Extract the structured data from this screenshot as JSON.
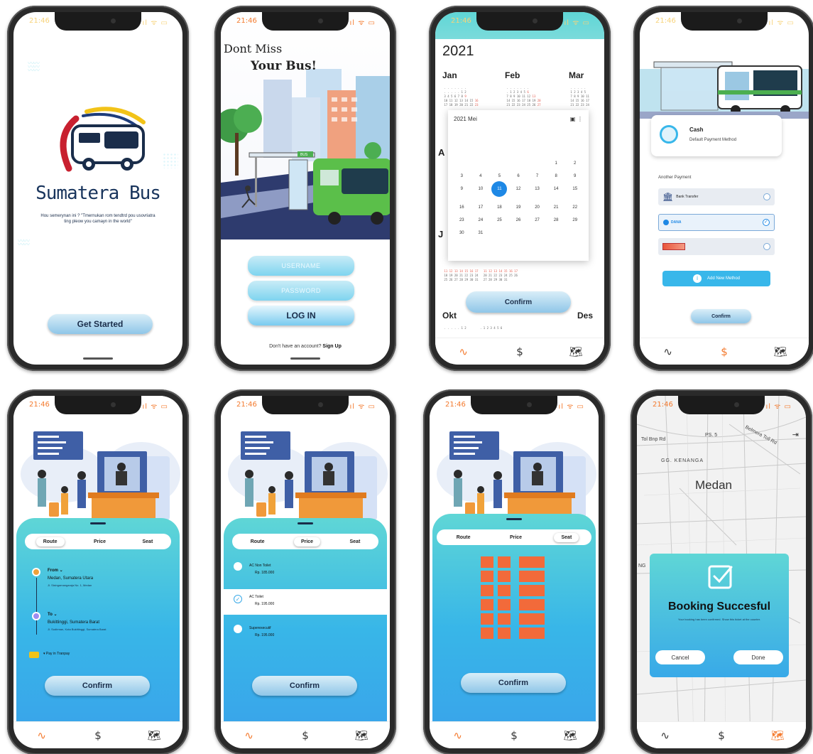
{
  "status": {
    "time": "21:46",
    "indicators": "ıl ᯤ ▭"
  },
  "screen_onboarding": {
    "brand_title": "Sumatera Bus",
    "quote": "Hou semerynan ini ? \"Tmernukan rom tendtrd pou usovriatra ting pleow you camayn in the world\"",
    "dots": "●●●●●",
    "get_started": "Get Started"
  },
  "screen_login": {
    "headline_1": "Dont Miss",
    "headline_2": "Your Bus!",
    "bus_stop_sign": "BUS",
    "username_placeholder": "USERNAME",
    "password_placeholder": "PASSWORD",
    "login_label": "LOG IN",
    "signup_prompt": "Don't have an account?",
    "signup_link": "Sign Up"
  },
  "screen_calendar": {
    "year": "2021",
    "months_top": [
      "Jan",
      "Feb",
      "Mar"
    ],
    "month_side_left": "A",
    "month_side_left_2": "J",
    "months_bottom": [
      "Okt",
      "Des"
    ],
    "dialog_title": "2021 Mei",
    "days": [
      "",
      "",
      "",
      "",
      "",
      "1",
      "2",
      "3",
      "4",
      "5",
      "6",
      "7",
      "8",
      "9",
      "9",
      "10",
      "11",
      "12",
      "13",
      "14",
      "15",
      "16",
      "17",
      "18",
      "19",
      "20",
      "21",
      "22",
      "23",
      "24",
      "25",
      "26",
      "27",
      "28",
      "29",
      "30",
      "31"
    ],
    "selected_day": "11",
    "confirm": "Confirm"
  },
  "screen_payment": {
    "default_title": "Cash",
    "default_sub": "Default Payment Method",
    "another_label": "Another Payment",
    "options": [
      {
        "name": "Bank Transfer"
      },
      {
        "name": "DANA"
      },
      {
        "name": ""
      }
    ],
    "add_method": "Add New Method",
    "confirm": "Confirm"
  },
  "tabs": {
    "route": "Route",
    "price": "Price",
    "seat": "Seat"
  },
  "screen_route": {
    "from_label": "From",
    "from_city": "Medan, Sumatera Utara",
    "from_addr": "Jl. Sisingamangaraja No. 1, Medan",
    "to_label": "To",
    "to_city": "Bukittinggi, Sumatera Barat",
    "to_addr": "Jl. Sudirman, Kota Bukittinggi, Sumatera Barat",
    "pay_label": "Pay in Tranpay",
    "confirm": "Confirm"
  },
  "screen_price": {
    "options": [
      {
        "name": "AC Non Toilet",
        "price": "Rp. 185.000"
      },
      {
        "name": "AC Toilet",
        "price": "Rp. 195.000"
      },
      {
        "name": "Superexecutif",
        "price": "Rp. 195.000"
      }
    ],
    "confirm": "Confirm"
  },
  "screen_seat": {
    "confirm": "Confirm"
  },
  "screen_success": {
    "map_labels": [
      "Tol Bnp Rd",
      "PS. 5",
      "Belmera Toll Rd",
      "GG. KENANGA",
      "Medan",
      "NG"
    ],
    "title": "Booking Succesful",
    "subtitle": "Your booking has been confirmed. Show this ticket at the counter.",
    "cancel": "Cancel",
    "done": "Done"
  },
  "nav": {
    "activity": "∿",
    "payment": "$",
    "map": "🗺"
  },
  "colors": {
    "accent": "#f47a2e",
    "sky_top": "#5fd6d6",
    "sky_bottom": "#39a6ea",
    "seat_orange": "#f26a3a"
  }
}
